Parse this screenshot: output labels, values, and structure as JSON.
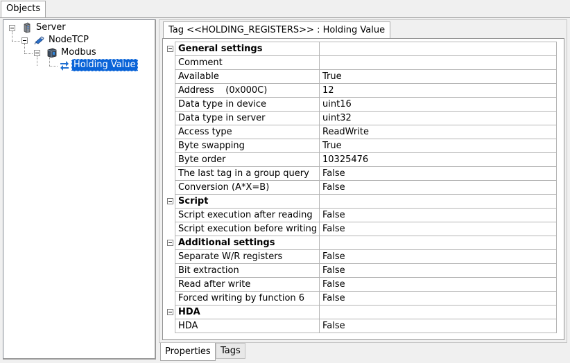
{
  "top_tabs": {
    "objects": "Objects"
  },
  "tree": {
    "server": "Server",
    "nodetcp": "NodeTCP",
    "modbus": "Modbus",
    "holding_value": "Holding Value"
  },
  "properties_tab": {
    "title": "Tag <<HOLDING_REGISTERS>> : Holding Value"
  },
  "grid": {
    "rows": [
      {
        "type": "category",
        "name": "General settings",
        "value": ""
      },
      {
        "type": "prop",
        "name": "Comment",
        "value": ""
      },
      {
        "type": "prop",
        "name": "Available",
        "value": "True"
      },
      {
        "type": "prop",
        "name": "Address    (0x000C)",
        "value": "12"
      },
      {
        "type": "prop",
        "name": "Data type in device",
        "value": "uint16"
      },
      {
        "type": "prop",
        "name": "Data type in server",
        "value": "uint32"
      },
      {
        "type": "prop",
        "name": "Access type",
        "value": "ReadWrite"
      },
      {
        "type": "prop",
        "name": "Byte swapping",
        "value": "True"
      },
      {
        "type": "prop",
        "name": "Byte order",
        "value": "10325476"
      },
      {
        "type": "prop",
        "name": "The last tag in a group query",
        "value": "False"
      },
      {
        "type": "prop",
        "name": "Conversion (A*X=B)",
        "value": "False"
      },
      {
        "type": "category",
        "name": "Script",
        "value": ""
      },
      {
        "type": "prop",
        "name": "Script execution after reading",
        "value": "False"
      },
      {
        "type": "prop",
        "name": "Script execution before writing",
        "value": "False"
      },
      {
        "type": "category",
        "name": "Additional settings",
        "value": ""
      },
      {
        "type": "prop",
        "name": "Separate W/R registers",
        "value": "False"
      },
      {
        "type": "prop",
        "name": "Bit extraction",
        "value": "False"
      },
      {
        "type": "prop",
        "name": "Read after write",
        "value": "False"
      },
      {
        "type": "prop",
        "name": "Forced writing by function 6",
        "value": "False"
      },
      {
        "type": "category",
        "name": "HDA",
        "value": ""
      },
      {
        "type": "prop",
        "name": "HDA",
        "value": "False"
      }
    ]
  },
  "bottom_tabs": {
    "properties": "Properties",
    "tags": "Tags"
  },
  "colors": {
    "selection": "#0a64d8",
    "grid_line": "#b4b4b4"
  }
}
